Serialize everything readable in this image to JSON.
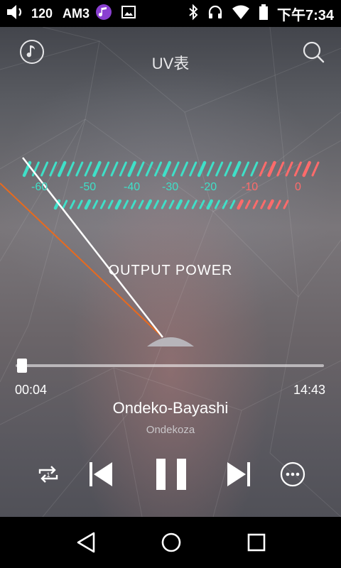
{
  "status_bar": {
    "volume_level": "120",
    "network_label": "AM3",
    "time": "下午7:34",
    "icons": [
      "volume-icon",
      "music-note-icon",
      "image-icon",
      "bluetooth-icon",
      "headphones-icon",
      "wifi-icon",
      "battery-icon"
    ]
  },
  "header": {
    "title": "UV表",
    "music_icon": "music-note-icon",
    "search_icon": "search-icon"
  },
  "meter": {
    "scale_labels": [
      "-60",
      "-50",
      "-40",
      "-30",
      "-20",
      "-10",
      "0"
    ],
    "caption": "OUTPUT  POWER",
    "colors": {
      "normal": "#3fe0c8",
      "peak": "#ff6b6b",
      "needle_left": "#ffffff",
      "needle_right": "#e86a1e"
    }
  },
  "player": {
    "elapsed": "00:04",
    "duration": "14:43",
    "progress_fraction": 0.005,
    "title": "Ondeko-Bayashi",
    "artist": "Ondekoza",
    "controls": [
      "repeat-icon",
      "previous-icon",
      "pause-icon",
      "next-icon",
      "more-icon"
    ]
  },
  "nav": {
    "icons": [
      "back-icon",
      "home-icon",
      "recent-apps-icon"
    ]
  }
}
